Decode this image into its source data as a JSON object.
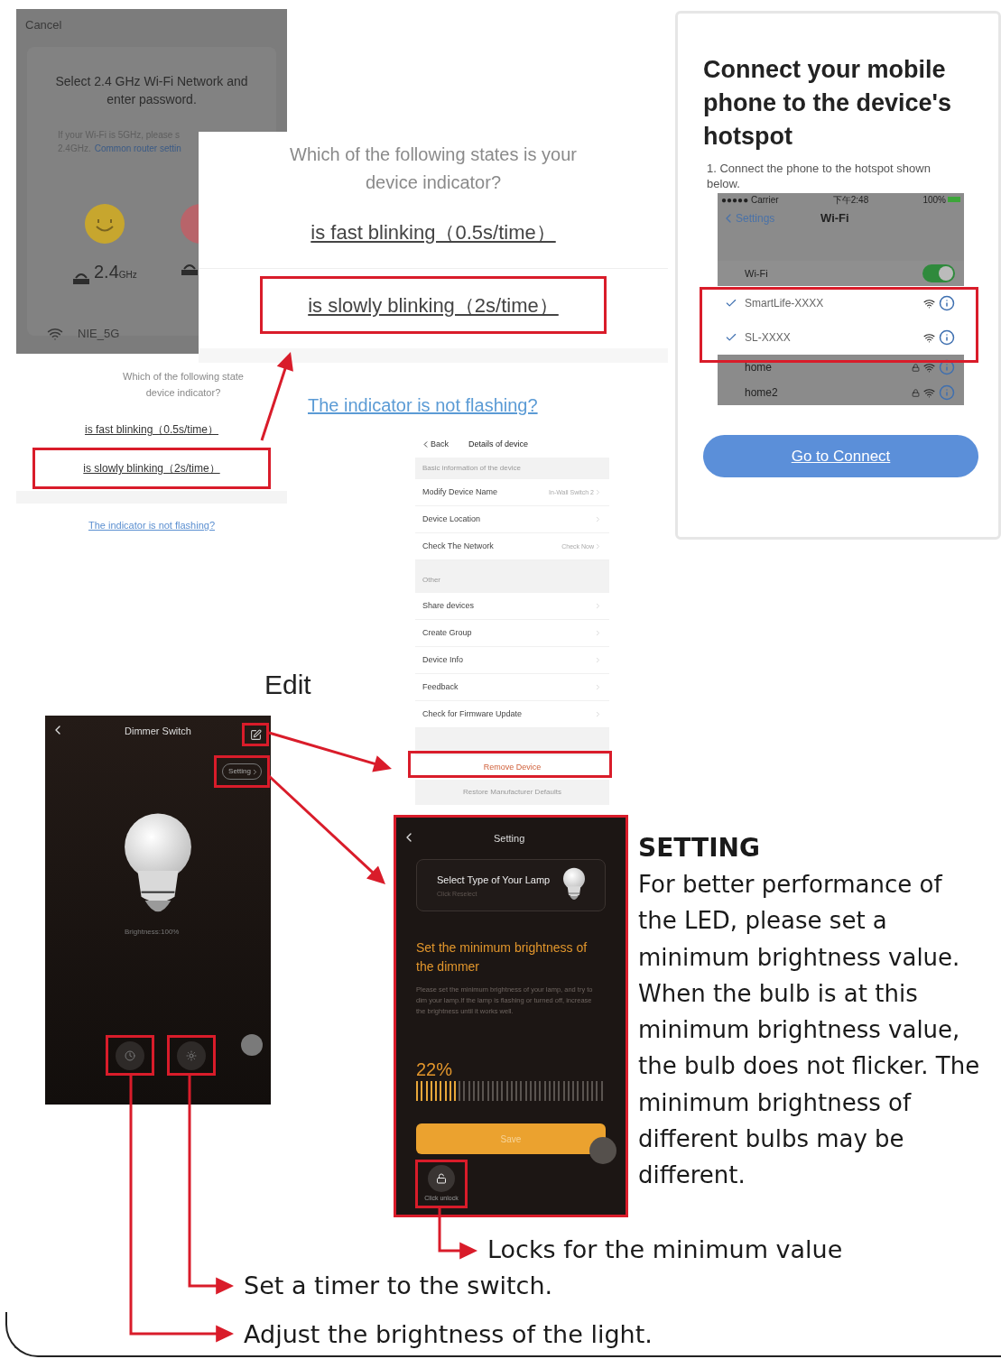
{
  "wifi_screen": {
    "cancel": "Cancel",
    "heading": "Select 2.4 GHz Wi-Fi Network and enter password.",
    "hint": "If your Wi-Fi is 5GHz, please s",
    "hint_prefix": "2.4GHz.",
    "hint_link": "Common router settin",
    "band_value": "2.4",
    "band_unit": "GHz",
    "network": "NIE_5G"
  },
  "small_sheet": {
    "question_lines": [
      "Which of the following state",
      "device indicator?"
    ],
    "options": [
      {
        "label": "is fast blinking（0.5s/time）",
        "selected": false
      },
      {
        "label": "is slowly blinking（2s/time）",
        "selected": true
      }
    ],
    "link": "The indicator is not flashing?"
  },
  "large_sheet": {
    "question_lines": [
      "Which of the following states is your",
      "device indicator?"
    ],
    "options": [
      {
        "label": "is fast blinking（0.5s/time）",
        "selected": false
      },
      {
        "label": "is slowly blinking（2s/time）",
        "selected": true
      }
    ],
    "link": "The indicator is not flashing?"
  },
  "hotspot": {
    "title": "Connect your mobile phone to the device's hotspot",
    "step": "1. Connect the phone to the hotspot shown below.",
    "phone": {
      "carrier": "●●●●● Carrier",
      "time": "下午2:48",
      "battery": "100%",
      "back": "Settings",
      "title": "Wi-Fi",
      "wifi_label": "Wi-Fi",
      "wifi_on": true,
      "networks": [
        {
          "name": "SmartLife-XXXX",
          "checked": true,
          "locked": false,
          "highlighted": true
        },
        {
          "name": "SL-XXXX",
          "checked": true,
          "locked": false,
          "highlighted": true
        },
        {
          "name": "home",
          "checked": false,
          "locked": true,
          "highlighted": false
        },
        {
          "name": "home2",
          "checked": false,
          "locked": true,
          "highlighted": false
        }
      ]
    },
    "button": "Go to Connect"
  },
  "details": {
    "back": "Back",
    "title": "Details of device",
    "sections": [
      {
        "header": "Basic information of the device",
        "rows": [
          {
            "label": "Modify Device Name",
            "value": "In-Wall Switch 2"
          },
          {
            "label": "Device Location"
          },
          {
            "label": "Check The Network",
            "value": "Check Now"
          }
        ]
      },
      {
        "header": "Other",
        "rows": [
          {
            "label": "Share devices"
          },
          {
            "label": "Create Group"
          },
          {
            "label": "Device Info"
          },
          {
            "label": "Feedback"
          },
          {
            "label": "Check for Firmware Update"
          }
        ]
      }
    ],
    "remove": "Remove Device",
    "restore": "Restore Manufacturer Defaults"
  },
  "edit_label": "Edit",
  "dimmer": {
    "title": "Dimmer Switch",
    "setting": "Setting",
    "brightness": "Brightness:100%"
  },
  "setting_screen": {
    "title": "Setting",
    "lamp_title": "Select Type of Your Lamp",
    "lamp_sub": "Click Reselect",
    "heading": "Set the minimum brightness of the dimmer",
    "body": "Please set the minimum brightness of your lamp, and try to dim your lamp.If the lamp is flashing or turned off, increase the brightness until it works well.",
    "reading": "22%",
    "level": 0.22,
    "save": "Save",
    "lock_label": "Click unlock"
  },
  "setting_note": {
    "title": "SETTING",
    "lines": [
      "For better performance of",
      "the LED, please set a",
      "minimum brightness value.",
      "When the bulb is at this",
      "minimum brightness value,",
      "the bulb does not flicker. The",
      "minimum brightness of",
      "different bulbs may be",
      "different."
    ]
  },
  "captions": [
    "Locks for the minimum value",
    "Set a timer to the switch.",
    "Adjust the brightness of the light."
  ]
}
